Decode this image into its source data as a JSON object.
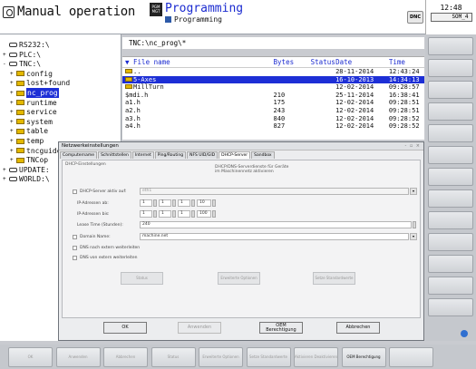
{
  "header": {
    "mode_title": "Manual operation",
    "prog_icon_text": "PGM MGT",
    "prog_title": "Programming",
    "prog_subtitle": "Programming",
    "dnc_label": "DNC",
    "clock": "12:48",
    "som_label": "SOM_4"
  },
  "tree": [
    {
      "label": "RS232:\\",
      "icon": "drive",
      "exp": "",
      "indent": 0
    },
    {
      "label": "PLC:\\",
      "icon": "drive",
      "exp": "+",
      "indent": 0
    },
    {
      "label": "TNC:\\",
      "icon": "drive",
      "exp": "-",
      "indent": 0
    },
    {
      "label": "config",
      "icon": "folder",
      "exp": "+",
      "indent": 1
    },
    {
      "label": "lost+found",
      "icon": "folder",
      "exp": "+",
      "indent": 1
    },
    {
      "label": "nc_prog",
      "icon": "folder",
      "exp": "+",
      "indent": 1,
      "selected": true
    },
    {
      "label": "runtime",
      "icon": "folder",
      "exp": "+",
      "indent": 1
    },
    {
      "label": "service",
      "icon": "folder",
      "exp": "+",
      "indent": 1
    },
    {
      "label": "system",
      "icon": "folder",
      "exp": "+",
      "indent": 1
    },
    {
      "label": "table",
      "icon": "folder",
      "exp": "+",
      "indent": 1
    },
    {
      "label": "temp",
      "icon": "folder",
      "exp": "+",
      "indent": 1
    },
    {
      "label": "tncguide",
      "icon": "folder",
      "exp": "+",
      "indent": 1
    },
    {
      "label": "TNCop",
      "icon": "folder",
      "exp": "+",
      "indent": 1
    },
    {
      "label": "UPDATE:",
      "icon": "drive",
      "exp": "+",
      "indent": 0
    },
    {
      "label": "WORLD:\\",
      "icon": "drive",
      "exp": "+",
      "indent": 0
    }
  ],
  "file_pane": {
    "path": "TNC:\\nc_prog\\*",
    "columns": [
      "File name",
      "Bytes",
      "Status",
      "Date",
      "Time"
    ],
    "rows": [
      {
        "name": "..",
        "bytes": "",
        "status": "",
        "date": "28-11-2014",
        "time": "12:43:24",
        "folder": true
      },
      {
        "name": "5-Axes",
        "bytes": "",
        "status": "",
        "date": "16-10-2013",
        "time": "14:34:13",
        "folder": true,
        "selected": true
      },
      {
        "name": "MillTurn",
        "bytes": "",
        "status": "",
        "date": "12-02-2014",
        "time": "09:28:57",
        "folder": true
      },
      {
        "name": "$mdi.h",
        "bytes": "210",
        "status": "",
        "date": "25-11-2014",
        "time": "16:38:41"
      },
      {
        "name": "a1.h",
        "bytes": "175",
        "status": "",
        "date": "12-02-2014",
        "time": "09:28:51"
      },
      {
        "name": "a2.h",
        "bytes": "243",
        "status": "",
        "date": "12-02-2014",
        "time": "09:28:51"
      },
      {
        "name": "a3.h",
        "bytes": "840",
        "status": "",
        "date": "12-02-2014",
        "time": "09:28:52"
      },
      {
        "name": "a4.h",
        "bytes": "827",
        "status": "",
        "date": "12-02-2014",
        "time": "09:28:52"
      }
    ]
  },
  "dialog": {
    "title": "Netzwerkeinstellungen",
    "window_controls": "- ▫ ×",
    "tabs": [
      "Computername",
      "Schnittstellen",
      "Internet",
      "Ping/Routing",
      "NFS UID/GID",
      "DHCP-Server",
      "Sandbox"
    ],
    "section_label": "DHCP-Einstellungen",
    "info_line1": "DHCP/DNS-Serverdienste für Geräte",
    "info_line2": "im Maschinennetz aktivieren",
    "dhcp_active_label": "DHCP-Server aktiv auf:",
    "dhcp_interface_value": "eth1",
    "ip_from_label": "IP-Adressen ab:",
    "ip_from": [
      "1",
      "1",
      "1",
      "10"
    ],
    "ip_to_label": "IP-Adressen bis:",
    "ip_to": [
      "1",
      "1",
      "1",
      "100"
    ],
    "lease_label": "Lease Time (Stunden):",
    "lease_value": "240",
    "domain_label": "Domain Name:",
    "domain_value": "machine.net",
    "dns_ext_label": "DNS nach extern weiterleiten",
    "dns_int_label": "DNS von extern weiterleiten",
    "mid_buttons": [
      "Status",
      "Erweiterte Optionen",
      "Setze Standardwerte"
    ],
    "buttons": {
      "ok": "OK",
      "apply": "Anwenden",
      "oem": "OEM Berechtigung",
      "cancel": "Abbrechen"
    }
  },
  "softkeys": [
    "OK",
    "Anwenden",
    "Abbrechen",
    "Status",
    "Erweiterte Optionen",
    "Setze Standardwerte",
    "Aktivieren Deaktivieren",
    "OEM Berechtigung"
  ]
}
